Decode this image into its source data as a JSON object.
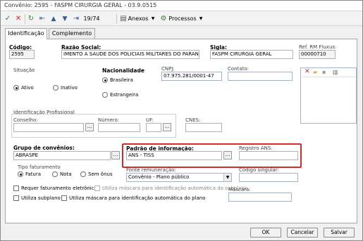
{
  "window": {
    "title": "Convênio: 2595 - FASPM CIRURGIA GERAL - 03.9.0515"
  },
  "toolbar": {
    "counter": "19/74",
    "anexos_label": "Anexos",
    "processos_label": "Processos",
    "icons": [
      "checkmark-icon",
      "close-icon",
      "refresh-icon",
      "first-record-icon",
      "previous-record-icon",
      "next-record-icon",
      "last-record-icon",
      "folder-icon",
      "folder-icon",
      "gear-icon",
      "chevron-down-icon"
    ]
  },
  "tabs": [
    "Identificação",
    "Complemento"
  ],
  "fields": {
    "codigo": {
      "label": "Código:",
      "value": "2595"
    },
    "razao_social": {
      "label": "Razão Social:",
      "value": "IMENTO A SAUDE DOS POLICIAIS MILITARES DO PARANA"
    },
    "sigla": {
      "label": "Sigla:",
      "value": "FASPM CIRURGIA GERAL"
    },
    "ref_rm": {
      "label": "Ref. RM Fluxus:",
      "value": "00000710"
    },
    "cnpj": {
      "label": "CNPJ:",
      "value": "07.975.281/0001-47"
    },
    "contato": {
      "label": "Contato:",
      "value": ""
    },
    "conselho": {
      "label": "Conselho:",
      "value": ""
    },
    "numero": {
      "label": "Número:",
      "value": ""
    },
    "uf": {
      "label": "UF:",
      "value": ""
    },
    "cnes": {
      "label": "CNES:",
      "value": ""
    },
    "grupo": {
      "label": "Grupo de convênios:",
      "value": "ABRASPE"
    },
    "padrao": {
      "label": "Padrão de informação:",
      "value": "ANS - TISS"
    },
    "registro_ans": {
      "label": "Registro ANS:",
      "value": ""
    },
    "fonte": {
      "label": "Fonte remuneração:",
      "value": "Convênio - Plano público"
    },
    "codigo_singular": {
      "label": "Código singular:",
      "value": ""
    },
    "mascara": {
      "label": "Máscara:",
      "value": ""
    }
  },
  "situacao": {
    "label": "Situação",
    "options": [
      "Ativo",
      "Inativo"
    ],
    "selected": "Ativo"
  },
  "nacionalidade": {
    "label": "Nacionalidade",
    "options": [
      "Brasileira",
      "Estrangeira"
    ],
    "selected": "Brasileira"
  },
  "identificacao_profissional": {
    "label": "Identificação Profissional"
  },
  "tipo_faturamento": {
    "label": "Tipo faturamento",
    "options": [
      "Fatura",
      "Nota",
      "Sem ônus"
    ],
    "selected": "Fatura"
  },
  "checkboxes": {
    "requer_eletronico": "Requer faturamento eletrônico",
    "mascara_subplano": "Utiliza máscara para identificação automática do subplano",
    "utiliza_subplano": "Utiliza subplano",
    "mascara_plano": "Utiliza máscara para identificação automática do plano"
  },
  "footer": {
    "ok": "OK",
    "cancel": "Cancelar",
    "save": "Salvar"
  },
  "colors": {
    "highlight": "#d32a2a",
    "delete": "#d32a2a",
    "folder": "#e2a93a"
  },
  "browse_glyph": "..."
}
